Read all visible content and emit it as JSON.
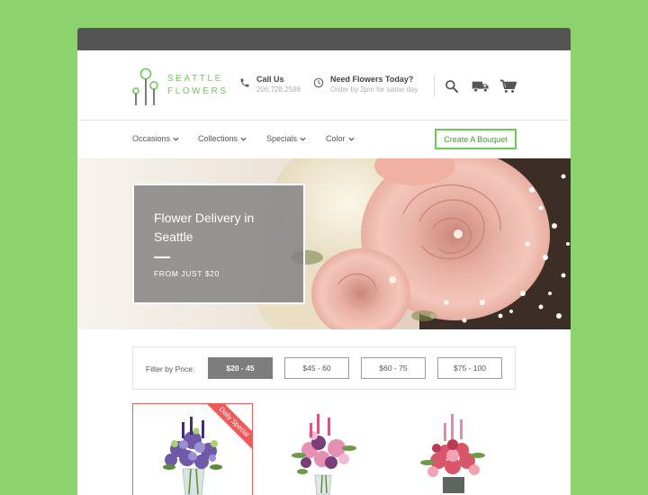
{
  "brand": {
    "line1": "SEATTLE",
    "line2": "FLOWERS",
    "accent": "#6bcb57"
  },
  "header": {
    "call_title": "Call Us",
    "call_number": "206.728.2588",
    "need_title": "Need Flowers Today?",
    "need_sub": "Order by 2pm for same day",
    "icons": [
      "phone-icon",
      "clock-icon",
      "search-icon",
      "truck-icon",
      "cart-icon"
    ]
  },
  "nav": {
    "items": [
      "Occasions",
      "Collections",
      "Specials",
      "Color"
    ],
    "cta": "Create A Bouquet"
  },
  "hero": {
    "title": "Flower Delivery in Seattle",
    "subtitle": "FROM JUST $20"
  },
  "filter": {
    "label": "Filter by Price:",
    "options": [
      "$20 - 45",
      "$45 - 60",
      "$60 - 75",
      "$75 - 100"
    ],
    "selected": "$20 - 45"
  },
  "products": [
    {
      "badge": "Daily Special"
    }
  ],
  "colors": {
    "background": "#8dd36d",
    "titlebar": "#555555",
    "special": "#ee5b5b",
    "active_filter": "#7d7d7d"
  }
}
